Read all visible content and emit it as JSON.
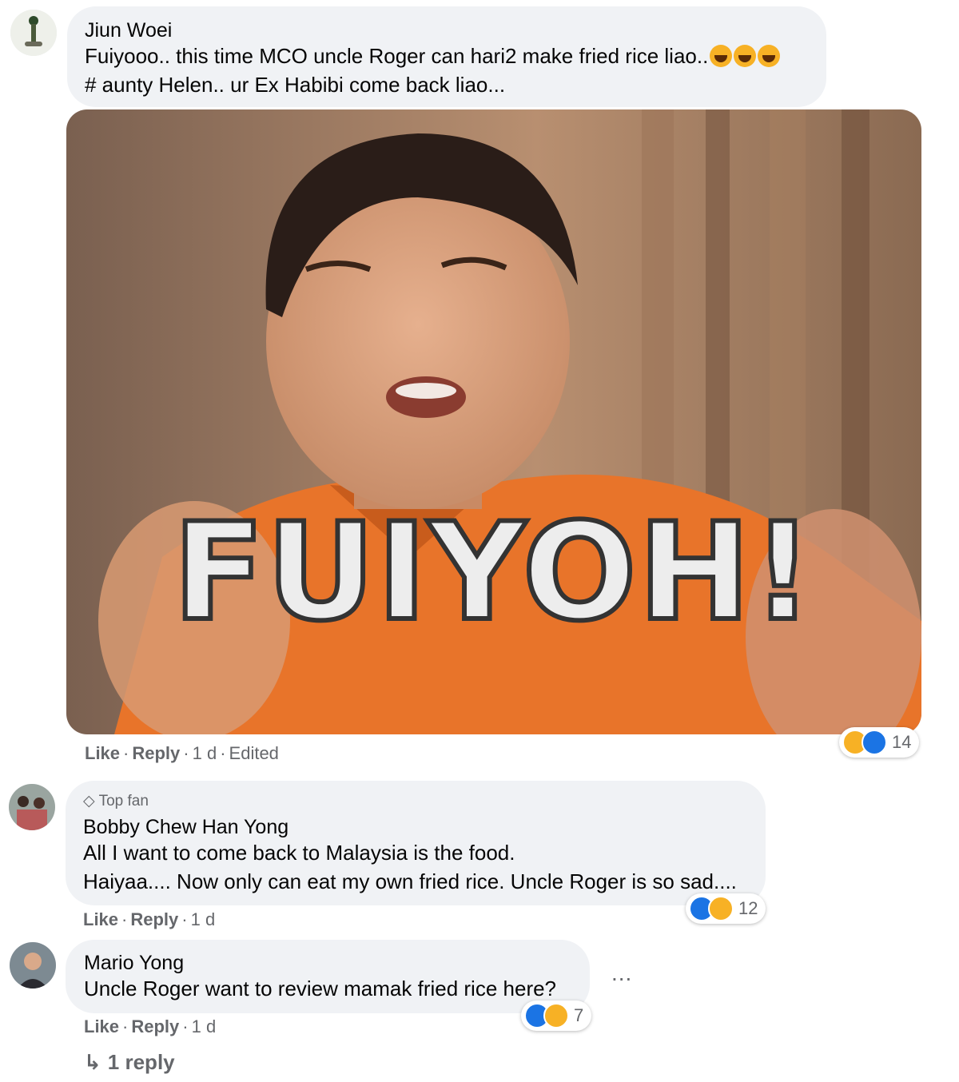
{
  "comments": [
    {
      "author": "Jiun Woei",
      "line1": "Fuiyooo.. this time MCO uncle Roger can hari2 make fried rice liao..",
      "line2": "# aunty Helen.. ur Ex Habibi come back liao...",
      "emojis": [
        "haha-emoji",
        "haha-emoji",
        "haha-emoji"
      ],
      "gif_caption": "FUIYOH!",
      "like": "Like",
      "reply": "Reply",
      "time": "1 d",
      "edited": "Edited",
      "reaction_count": "14",
      "reaction_icons": [
        "haha-icon",
        "like-icon"
      ]
    },
    {
      "badge": "Top fan",
      "author": "Bobby Chew Han Yong",
      "line1": "All I want to come back to Malaysia is the food.",
      "line2": "Haiyaa.... Now only can eat my own fried rice. Uncle Roger is so sad....",
      "like": "Like",
      "reply": "Reply",
      "time": "1 d",
      "reaction_count": "12",
      "reaction_icons": [
        "like-icon",
        "haha-icon"
      ]
    },
    {
      "author": "Mario Yong",
      "line1": "Uncle Roger want to review mamak fried rice here?",
      "like": "Like",
      "reply": "Reply",
      "time": "1 d",
      "reaction_count": "7",
      "reaction_icons": [
        "like-icon",
        "haha-icon"
      ],
      "more": "...",
      "replies_link": "1 reply"
    }
  ],
  "colors": {
    "bubble": "#f0f2f5",
    "secondary_text": "#65676b",
    "like_blue": "#1b74e4",
    "haha_yellow": "#f7b125",
    "shirt_orange": "#e8742a"
  }
}
